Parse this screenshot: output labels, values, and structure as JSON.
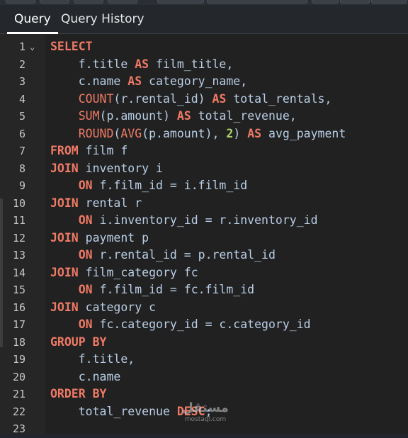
{
  "tabs": [
    {
      "label": "Query",
      "active": true
    },
    {
      "label": "Query History",
      "active": false
    }
  ],
  "editor": {
    "fold_icon": "chevron-down-icon",
    "lines": [
      {
        "num": "1",
        "segments": [
          {
            "t": "SELECT",
            "c": "kw"
          }
        ],
        "fold": true
      },
      {
        "num": "2",
        "segments": [
          {
            "t": "    f.title ",
            "c": "id"
          },
          {
            "t": "AS",
            "c": "kw"
          },
          {
            "t": " film_title,",
            "c": "id"
          }
        ]
      },
      {
        "num": "3",
        "segments": [
          {
            "t": "    c.name ",
            "c": "id"
          },
          {
            "t": "AS",
            "c": "kw"
          },
          {
            "t": " category_name,",
            "c": "id"
          }
        ]
      },
      {
        "num": "4",
        "segments": [
          {
            "t": "    ",
            "c": "id"
          },
          {
            "t": "COUNT",
            "c": "fn"
          },
          {
            "t": "(r.rental_id) ",
            "c": "id"
          },
          {
            "t": "AS",
            "c": "kw"
          },
          {
            "t": " total_rentals,",
            "c": "id"
          }
        ]
      },
      {
        "num": "5",
        "segments": [
          {
            "t": "    ",
            "c": "id"
          },
          {
            "t": "SUM",
            "c": "fn"
          },
          {
            "t": "(p.amount) ",
            "c": "id"
          },
          {
            "t": "AS",
            "c": "kw"
          },
          {
            "t": " total_revenue,",
            "c": "id"
          }
        ]
      },
      {
        "num": "6",
        "segments": [
          {
            "t": "    ",
            "c": "id"
          },
          {
            "t": "ROUND",
            "c": "fn"
          },
          {
            "t": "(",
            "c": "id"
          },
          {
            "t": "AVG",
            "c": "fn"
          },
          {
            "t": "(p.amount), ",
            "c": "id"
          },
          {
            "t": "2",
            "c": "num"
          },
          {
            "t": ") ",
            "c": "id"
          },
          {
            "t": "AS",
            "c": "kw"
          },
          {
            "t": " avg_payment",
            "c": "id"
          }
        ]
      },
      {
        "num": "7",
        "segments": [
          {
            "t": "FROM",
            "c": "kw"
          },
          {
            "t": " film f",
            "c": "id"
          }
        ]
      },
      {
        "num": "8",
        "segments": [
          {
            "t": "JOIN",
            "c": "kw"
          },
          {
            "t": " inventory i",
            "c": "id"
          }
        ]
      },
      {
        "num": "9",
        "segments": [
          {
            "t": "    ",
            "c": "id"
          },
          {
            "t": "ON",
            "c": "kw"
          },
          {
            "t": " f.film_id = i.film_id",
            "c": "id"
          }
        ]
      },
      {
        "num": "10",
        "segments": [
          {
            "t": "JOIN",
            "c": "kw"
          },
          {
            "t": " rental r",
            "c": "id"
          }
        ]
      },
      {
        "num": "11",
        "segments": [
          {
            "t": "    ",
            "c": "id"
          },
          {
            "t": "ON",
            "c": "kw"
          },
          {
            "t": " i.inventory_id = r.inventory_id",
            "c": "id"
          }
        ]
      },
      {
        "num": "12",
        "segments": [
          {
            "t": "JOIN",
            "c": "kw"
          },
          {
            "t": " payment p",
            "c": "id"
          }
        ]
      },
      {
        "num": "13",
        "segments": [
          {
            "t": "    ",
            "c": "id"
          },
          {
            "t": "ON",
            "c": "kw"
          },
          {
            "t": " r.rental_id = p.rental_id",
            "c": "id"
          }
        ]
      },
      {
        "num": "14",
        "segments": [
          {
            "t": "JOIN",
            "c": "kw"
          },
          {
            "t": " film_category fc",
            "c": "id"
          }
        ]
      },
      {
        "num": "15",
        "segments": [
          {
            "t": "    ",
            "c": "id"
          },
          {
            "t": "ON",
            "c": "kw"
          },
          {
            "t": " f.film_id = fc.film_id",
            "c": "id"
          }
        ]
      },
      {
        "num": "16",
        "segments": [
          {
            "t": "JOIN",
            "c": "kw"
          },
          {
            "t": " category c",
            "c": "id"
          }
        ]
      },
      {
        "num": "17",
        "segments": [
          {
            "t": "    ",
            "c": "id"
          },
          {
            "t": "ON",
            "c": "kw"
          },
          {
            "t": " fc.category_id = c.category_id",
            "c": "id"
          }
        ]
      },
      {
        "num": "18",
        "segments": [
          {
            "t": "GROUP BY",
            "c": "kw"
          }
        ]
      },
      {
        "num": "19",
        "segments": [
          {
            "t": "    f.title,",
            "c": "id"
          }
        ]
      },
      {
        "num": "20",
        "segments": [
          {
            "t": "    c.name",
            "c": "id"
          }
        ]
      },
      {
        "num": "21",
        "segments": [
          {
            "t": "ORDER BY",
            "c": "kw"
          }
        ]
      },
      {
        "num": "22",
        "segments": [
          {
            "t": "    total_revenue ",
            "c": "id"
          },
          {
            "t": "DESC",
            "c": "kw"
          },
          {
            "t": ";",
            "c": "id"
          }
        ]
      },
      {
        "num": "23",
        "segments": []
      }
    ]
  },
  "watermark": {
    "logo": "مستقل",
    "text": "mostaql.com"
  },
  "colors": {
    "keyword": "#ef7a66",
    "identifier": "#b9cee6",
    "number": "#a9d36a",
    "background": "#212121"
  }
}
